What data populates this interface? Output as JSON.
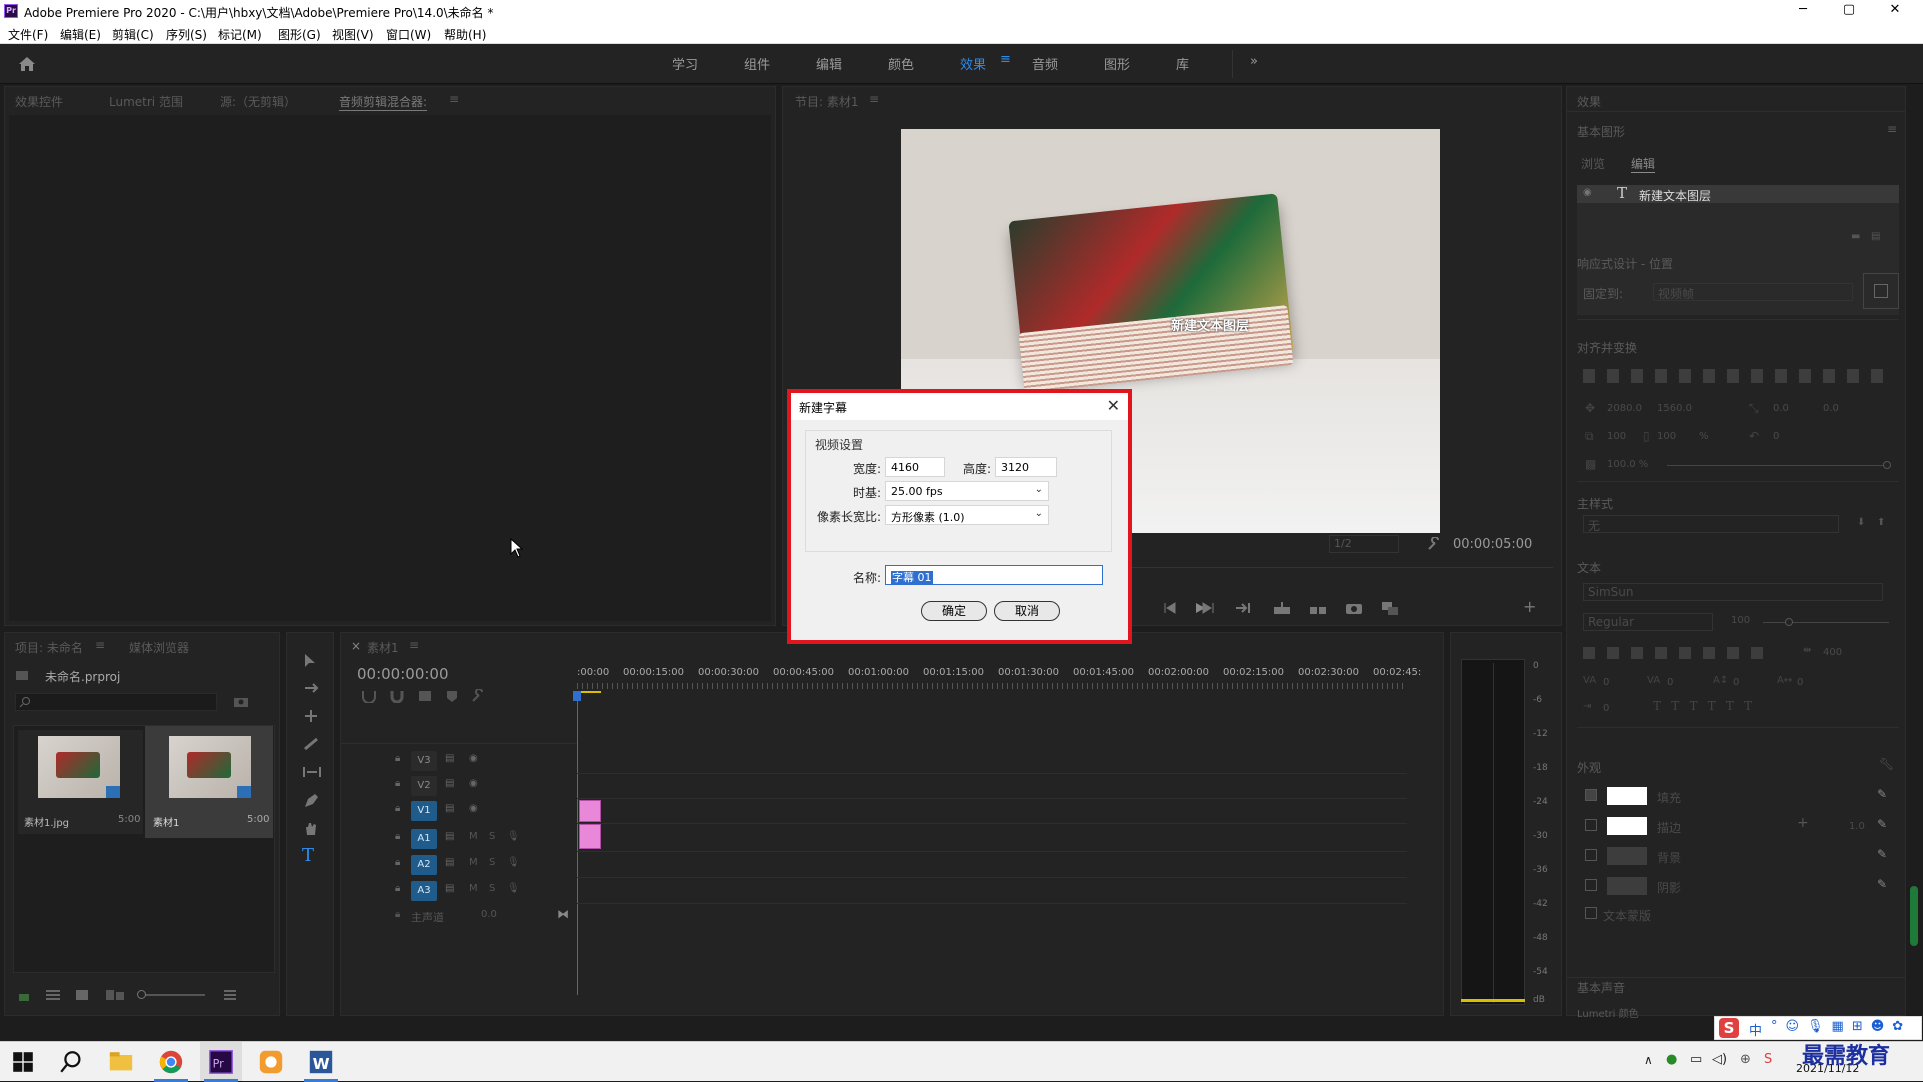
{
  "titlebar": {
    "logo": "Pr",
    "title": "Adobe Premiere Pro 2020 - C:\\用户\\hbxy\\文档\\Adobe\\Premiere Pro\\14.0\\未命名 *",
    "minimize": "─",
    "maximize": "▢",
    "close": "✕"
  },
  "menu": [
    "文件(F)",
    "编辑(E)",
    "剪辑(C)",
    "序列(S)",
    "标记(M)",
    "图形(G)",
    "视图(V)",
    "窗口(W)",
    "帮助(H)"
  ],
  "workspaces": [
    "学习",
    "组件",
    "编辑",
    "颜色",
    "效果",
    "音频",
    "图形",
    "库"
  ],
  "workspace_more": "»",
  "source_panel": {
    "tabs": [
      "效果控件",
      "Lumetri 范围",
      "源:（无剪辑）",
      "音频剪辑混合器:"
    ]
  },
  "program_monitor": {
    "tab": "节目: 素材1",
    "overlay_text": "新建文本图层",
    "timecode": "00:00:05:00",
    "zoom": "1/2"
  },
  "project": {
    "tabs": [
      "项目: 未命名",
      "媒体浏览器"
    ],
    "file": "未命名.prproj",
    "items": [
      {
        "name": "素材1.jpg",
        "dur": "5:00"
      },
      {
        "name": "素材1",
        "dur": "5:00"
      }
    ]
  },
  "timeline": {
    "tab": "素材1",
    "timecode": "00:00:00:00",
    "ruler": [
      ":00:00",
      "00:00:15:00",
      "00:00:30:00",
      "00:00:45:00",
      "00:01:00:00",
      "00:01:15:00",
      "00:01:30:00",
      "00:01:45:00",
      "00:02:00:00",
      "00:02:15:00",
      "00:02:30:00",
      "00:02:45:"
    ],
    "tracks": [
      {
        "id": "V3",
        "on": false
      },
      {
        "id": "V2",
        "on": false
      },
      {
        "id": "V1",
        "on": true
      },
      {
        "id": "A1",
        "on": true
      },
      {
        "id": "A2",
        "on": true
      },
      {
        "id": "A3",
        "on": true
      }
    ],
    "master": "主声道",
    "master_val": "0.0",
    "m": "M",
    "s": "S"
  },
  "meter": {
    "scale": [
      "0",
      "-6",
      "-12",
      "-18",
      "-24",
      "-30",
      "-36",
      "-42",
      "-48",
      "-54",
      "dB"
    ]
  },
  "right_panel": {
    "effects_title": "效果",
    "essential_graphics": "基本图形",
    "tabs": [
      "浏览",
      "编辑"
    ],
    "layer": "新建文本图层",
    "responsive": "响应式设计 - 位置",
    "pin_to": "固定到:",
    "pin_value": "视频帧",
    "align": "对齐并变换",
    "pos_x": "2080.0",
    "pos_y": "1560.0",
    "rot_a": "0.0",
    "rot_b": "0.0",
    "scale_w": "100",
    "scale_h": "100",
    "pct": "%",
    "rot": "0",
    "opacity": "100.0 %",
    "master_style": "主样式",
    "style_value": "无",
    "text_section": "文本",
    "font": "SimSun",
    "weight": "Regular",
    "size": "100",
    "tracking": "400",
    "va1": "0",
    "va2": "0",
    "va3": "0",
    "va4": "0",
    "va5": "0",
    "appearance": "外观",
    "fill": "填充",
    "stroke": "描边",
    "stroke_val": "1.0",
    "background": "背景",
    "shadow": "阴影",
    "mask": "文本蒙版",
    "essential_sound": "基本声音",
    "lumetri": "Lumetri 颜色"
  },
  "dialog": {
    "title": "新建字幕",
    "group": "视频设置",
    "width_label": "宽度:",
    "width": "4160",
    "height_label": "高度:",
    "height": "3120",
    "timebase_label": "时基:",
    "timebase": "25.00 fps",
    "par_label": "像素长宽比:",
    "par": "方形像素 (1.0)",
    "name_label": "名称:",
    "name": "字幕 01",
    "ok": "确定",
    "cancel": "取消"
  },
  "taskbar": {
    "ime": "中",
    "time": "2021/11/12",
    "watermark": "最需教育"
  },
  "colors": {
    "accent": "#2d8ceb",
    "dialog_border": "#e0151e",
    "clip": "#e987d9",
    "playhead": "#2f6fd0"
  }
}
